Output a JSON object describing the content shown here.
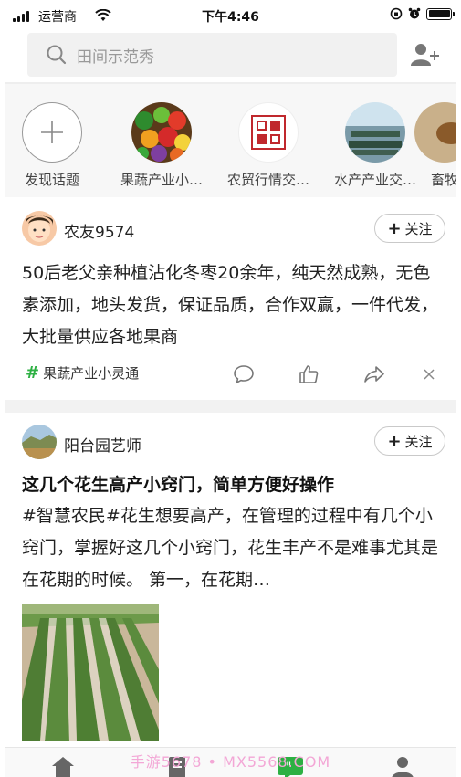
{
  "status_bar": {
    "carrier": "运营商",
    "time": "下午4:46"
  },
  "search": {
    "placeholder": "田间示范秀"
  },
  "topics": [
    {
      "label": "发现话题",
      "icon": "plus-icon"
    },
    {
      "label": "果蔬产业小…",
      "icon": "fruit-vegetable-image"
    },
    {
      "label": "农贸行情交…",
      "icon": "village-market-logo"
    },
    {
      "label": "水产产业交…",
      "icon": "fish-farm-image"
    },
    {
      "label": "畜牧",
      "icon": "livestock-image"
    }
  ],
  "posts": [
    {
      "username": "农友9574",
      "follow_label": "关注",
      "text": "50后老父亲种植沾化冬枣20余年，纯天然成熟，无色素添加，地头发货，保证品质，合作双赢，一件代发，大批量供应各地果商",
      "tag": "果蔬产业小灵通"
    },
    {
      "username": "阳台园艺师",
      "follow_label": "关注",
      "title": "这几个花生高产小窍门，简单方便好操作",
      "text": "#智慧农民#花生想要高产，在管理的过程中有几个小窍门，掌握好这几个小窍门，花生丰产不是难事尤其是在花期的时候。 第一，在花期…"
    }
  ],
  "bottom_nav": {
    "watermark": "手游5678 • MX5568.COM"
  },
  "colors": {
    "accent_green": "#2db043",
    "search_bg": "#f1f1f1",
    "section_bg": "#f7f7f7"
  }
}
